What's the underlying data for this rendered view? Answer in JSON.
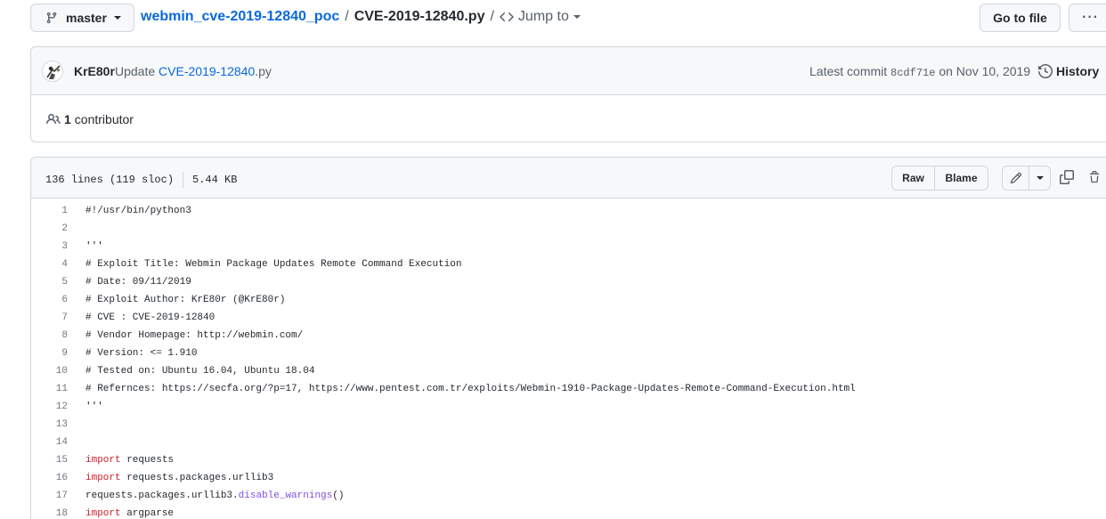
{
  "breadcrumb": {
    "branch": "master",
    "repo": "webmin_cve-2019-12840_poc",
    "separator": "/",
    "file": "CVE-2019-12840.py",
    "jump_to": "Jump to",
    "go_to_file": "Go to file",
    "more": "···"
  },
  "commit": {
    "author": "KrE80r",
    "message_prefix": "Update",
    "message_link": "CVE-2019-12840",
    "message_suffix": ".py",
    "latest_label": "Latest commit",
    "sha": "8cdf71e",
    "date_text": "on Nov 10, 2019",
    "history": "History",
    "contributors_count": "1",
    "contributors_label": "contributor"
  },
  "file": {
    "lines_info": "136 lines (119 sloc)",
    "size": "5.44 KB",
    "raw": "Raw",
    "blame": "Blame",
    "lines": [
      {
        "n": "1",
        "parts": [
          {
            "t": "#!/usr/bin/python3",
            "k": "cmt"
          }
        ]
      },
      {
        "n": "2",
        "parts": []
      },
      {
        "n": "3",
        "parts": [
          {
            "t": "'''",
            "k": "cmt"
          }
        ]
      },
      {
        "n": "4",
        "parts": [
          {
            "t": "# Exploit Title: Webmin Package Updates Remote Command Execution",
            "k": "cmt"
          }
        ]
      },
      {
        "n": "5",
        "parts": [
          {
            "t": "# Date: 09/11/2019",
            "k": "cmt"
          }
        ]
      },
      {
        "n": "6",
        "parts": [
          {
            "t": "# Exploit Author: KrE80r (@KrE80r)",
            "k": "cmt"
          }
        ]
      },
      {
        "n": "7",
        "parts": [
          {
            "t": "# CVE : CVE-2019-12840",
            "k": "cmt"
          }
        ]
      },
      {
        "n": "8",
        "parts": [
          {
            "t": "# Vendor Homepage: http://webmin.com/",
            "k": "cmt"
          }
        ]
      },
      {
        "n": "9",
        "parts": [
          {
            "t": "# Version: <= 1.910",
            "k": "cmt"
          }
        ]
      },
      {
        "n": "10",
        "parts": [
          {
            "t": "# Tested on: Ubuntu 16.04, Ubuntu 18.04",
            "k": "cmt"
          }
        ]
      },
      {
        "n": "11",
        "parts": [
          {
            "t": "# Refernces: https://secfa.org/?p=17, https://www.pentest.com.tr/exploits/Webmin-1910-Package-Updates-Remote-Command-Execution.html",
            "k": "cmt"
          }
        ]
      },
      {
        "n": "12",
        "parts": [
          {
            "t": "'''",
            "k": "cmt"
          }
        ]
      },
      {
        "n": "13",
        "parts": []
      },
      {
        "n": "14",
        "parts": []
      },
      {
        "n": "15",
        "parts": [
          {
            "t": "import",
            "k": "kw"
          },
          {
            "t": " requests",
            "k": ""
          }
        ]
      },
      {
        "n": "16",
        "parts": [
          {
            "t": "import",
            "k": "kw"
          },
          {
            "t": " requests.packages.urllib3",
            "k": ""
          }
        ]
      },
      {
        "n": "17",
        "parts": [
          {
            "t": "requests.packages.urllib3.",
            "k": ""
          },
          {
            "t": "disable_warnings",
            "k": "fn"
          },
          {
            "t": "()",
            "k": ""
          }
        ]
      },
      {
        "n": "18",
        "parts": [
          {
            "t": "import",
            "k": "kw"
          },
          {
            "t": " argparse",
            "k": ""
          }
        ]
      }
    ]
  },
  "colors": {
    "link": "#0969da",
    "keyword": "#cf222e",
    "function": "#8250df",
    "border": "#d0d7de",
    "header_bg": "#f6f8fa"
  }
}
